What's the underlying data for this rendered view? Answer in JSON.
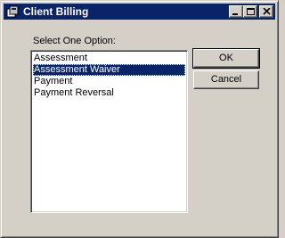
{
  "window": {
    "title": "Client Billing",
    "icon": "client-billing-app-icon",
    "caption_buttons": [
      "minimize-icon",
      "maximize-icon",
      "close-icon"
    ]
  },
  "dialog": {
    "prompt": "Select One Option:",
    "options": [
      {
        "label": "Assessment",
        "selected": false
      },
      {
        "label": "Assessment Waiver",
        "selected": true
      },
      {
        "label": "Payment",
        "selected": false
      },
      {
        "label": "Payment Reversal",
        "selected": false
      }
    ],
    "ok_label": "OK",
    "cancel_label": "Cancel"
  },
  "colors": {
    "titlebar": "#0a246a",
    "selection": "#0a246a",
    "face": "#d4d0c8"
  }
}
